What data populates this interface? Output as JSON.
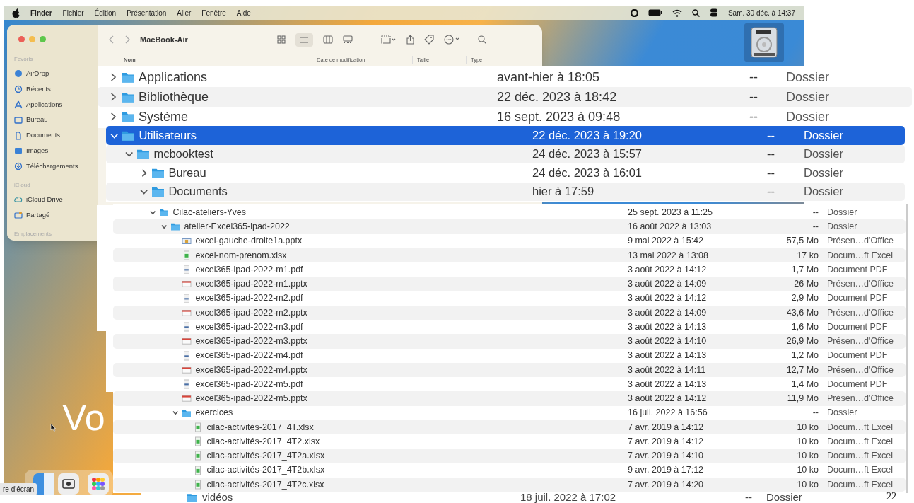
{
  "menubar": {
    "items": [
      "Finder",
      "Fichier",
      "Édition",
      "Présentation",
      "Aller",
      "Fenêtre",
      "Aide"
    ],
    "clock": "Sam. 30 déc. à 14:37"
  },
  "finder_window": {
    "title": "MacBook-Air",
    "sidebar": [
      {
        "title": "Favoris",
        "items": [
          "AirDrop",
          "Récents",
          "Applications",
          "Bureau",
          "Documents",
          "Images",
          "Téléchargements"
        ]
      },
      {
        "title": "iCloud",
        "items": [
          "iCloud Drive",
          "Partagé"
        ]
      },
      {
        "title": "Emplacements"
      }
    ],
    "columns": [
      "Nom",
      "Date de modification",
      "Taille",
      "Type"
    ]
  },
  "panels": [
    {
      "rows": [
        {
          "kind": "folder",
          "name": "Applications",
          "date": "avant-hier à 18:05",
          "size": "--",
          "type": "Dossier",
          "expanded": false,
          "selected": false
        },
        {
          "kind": "folder",
          "name": "Bibliothèque",
          "date": "22 déc. 2023 à 18:42",
          "size": "--",
          "type": "Dossier",
          "expanded": false,
          "selected": false
        },
        {
          "kind": "folder",
          "name": "Système",
          "date": "16 sept. 2023 à 09:48",
          "size": "--",
          "type": "Dossier",
          "expanded": false,
          "selected": false
        }
      ]
    },
    {
      "rows": [
        {
          "kind": "folder",
          "name": "Utilisateurs",
          "date": "22 déc. 2023 à 19:20",
          "size": "--",
          "type": "Dossier",
          "expanded": true,
          "selected": true,
          "children": [
            {
              "kind": "folder",
              "name": "mcbooktest",
              "date": "24 déc. 2023 à 15:57",
              "size": "--",
              "type": "Dossier",
              "expanded": true,
              "selected": false,
              "children": [
                {
                  "kind": "folder",
                  "name": "Bureau",
                  "date": "24 déc. 2023 à 16:01",
                  "size": "--",
                  "type": "Dossier",
                  "expanded": false,
                  "selected": false
                },
                {
                  "kind": "folder",
                  "name": "Documents",
                  "date": "hier à 17:59",
                  "size": "--",
                  "type": "Dossier",
                  "expanded": true,
                  "selected": false
                }
              ]
            }
          ]
        }
      ]
    },
    {
      "rows": [
        {
          "kind": "folder",
          "name": "Cilac-ateliers-Yves",
          "date": "25 sept. 2023 à 11:25",
          "size": "--",
          "type": "Dossier",
          "expanded": true,
          "selected": false,
          "children": [
            {
              "kind": "folder",
              "name": "atelier-Excel365-ipad-2022",
              "date": "16 août 2022 à 13:03",
              "size": "--",
              "type": "Dossier",
              "expanded": true,
              "selected": false,
              "children": [
                {
                  "kind": "slides",
                  "name": "excel-gauche-droite1a.pptx",
                  "date": "9 mai 2022 à 15:42",
                  "size": "57,5 Mo",
                  "type": "Présen…d'Office",
                  "selected": false
                },
                {
                  "kind": "xlsx",
                  "name": "excel-nom-prenom.xlsx",
                  "date": "13 mai 2022 à 13:08",
                  "size": "17 ko",
                  "type": "Docum…ft Excel",
                  "selected": false
                },
                {
                  "kind": "pdf",
                  "name": "excel365-ipad-2022-m1.pdf",
                  "date": "3 août 2022 à 14:12",
                  "size": "1,7 Mo",
                  "type": "Document PDF",
                  "selected": false
                },
                {
                  "kind": "pptx",
                  "name": "excel365-ipad-2022-m1.pptx",
                  "date": "3 août 2022 à 14:09",
                  "size": "26 Mo",
                  "type": "Présen…d'Office",
                  "selected": false
                },
                {
                  "kind": "pdf",
                  "name": "excel365-ipad-2022-m2.pdf",
                  "date": "3 août 2022 à 14:12",
                  "size": "2,9 Mo",
                  "type": "Document PDF",
                  "selected": false
                },
                {
                  "kind": "pptx",
                  "name": "excel365-ipad-2022-m2.pptx",
                  "date": "3 août 2022 à 14:09",
                  "size": "43,6 Mo",
                  "type": "Présen…d'Office",
                  "selected": false
                },
                {
                  "kind": "pdf",
                  "name": "excel365-ipad-2022-m3.pdf",
                  "date": "3 août 2022 à 14:13",
                  "size": "1,6 Mo",
                  "type": "Document PDF",
                  "selected": false
                },
                {
                  "kind": "pptx",
                  "name": "excel365-ipad-2022-m3.pptx",
                  "date": "3 août 2022 à 14:10",
                  "size": "26,9 Mo",
                  "type": "Présen…d'Office",
                  "selected": false
                },
                {
                  "kind": "pdf",
                  "name": "excel365-ipad-2022-m4.pdf",
                  "date": "3 août 2022 à 14:13",
                  "size": "1,2 Mo",
                  "type": "Document PDF",
                  "selected": false
                },
                {
                  "kind": "pptx",
                  "name": "excel365-ipad-2022-m4.pptx",
                  "date": "3 août 2022 à 14:11",
                  "size": "12,7 Mo",
                  "type": "Présen…d'Office",
                  "selected": false
                },
                {
                  "kind": "pdf",
                  "name": "excel365-ipad-2022-m5.pdf",
                  "date": "3 août 2022 à 14:13",
                  "size": "1,4 Mo",
                  "type": "Document PDF",
                  "selected": false
                },
                {
                  "kind": "pptx",
                  "name": "excel365-ipad-2022-m5.pptx",
                  "date": "3 août 2022 à 14:12",
                  "size": "11,9 Mo",
                  "type": "Présen…d'Office",
                  "selected": false
                },
                {
                  "kind": "folder",
                  "name": "exercices",
                  "date": "16 juil. 2022 à 16:56",
                  "size": "--",
                  "type": "Dossier",
                  "expanded": true,
                  "selected": false,
                  "children": [
                    {
                      "kind": "xlsx",
                      "name": "cilac-activités-2017_4T.xlsx",
                      "date": "7 avr. 2019 à 14:12",
                      "size": "10 ko",
                      "type": "Docum…ft Excel",
                      "selected": false
                    },
                    {
                      "kind": "xlsx",
                      "name": "cilac-activités-2017_4T2.xlsx",
                      "date": "7 avr. 2019 à 14:12",
                      "size": "10 ko",
                      "type": "Docum…ft Excel",
                      "selected": false
                    },
                    {
                      "kind": "xlsx",
                      "name": "cilac-activités-2017_4T2a.xlsx",
                      "date": "7 avr. 2019 à 14:10",
                      "size": "10 ko",
                      "type": "Docum…ft Excel",
                      "selected": false
                    },
                    {
                      "kind": "xlsx",
                      "name": "cilac-activités-2017_4T2b.xlsx",
                      "date": "9 avr. 2019 à 17:12",
                      "size": "10 ko",
                      "type": "Docum…ft Excel",
                      "selected": false
                    },
                    {
                      "kind": "xlsx",
                      "name": "cilac-activités-2017_4T2c.xlsx",
                      "date": "7 avr. 2019 à 14:20",
                      "size": "10 ko",
                      "type": "Docum…ft Excel",
                      "selected": false
                    }
                  ]
                }
              ]
            }
          ]
        }
      ]
    }
  ],
  "bottom_row": {
    "name": "vidéos",
    "date": "18 juil. 2022 à 17:02",
    "size": "--",
    "type": "Dossier"
  },
  "slide_title": "Vo",
  "dock_tooltip": "re d'écran",
  "page_number": "22"
}
